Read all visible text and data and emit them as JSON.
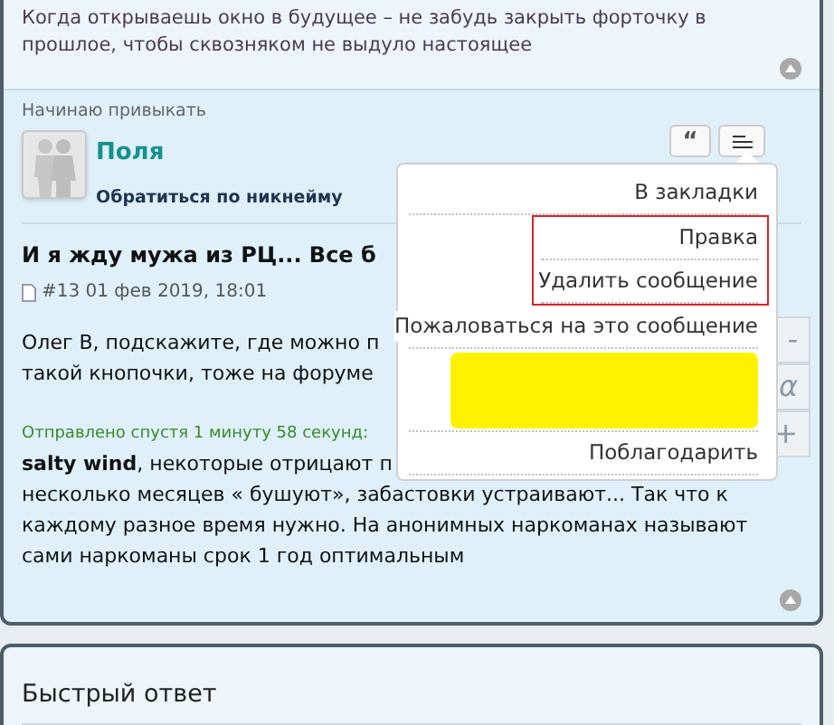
{
  "signature": {
    "text": "Когда открываешь окно в будущее – не забудь закрыть форточку в прошлое, чтобы сквозняком не выдуло настоящее"
  },
  "post": {
    "user_title": "Начинаю привыкать",
    "username": "Поля",
    "mention_link": "Обратиться по никнейму",
    "thread_title": "И я жду мужа из РЦ... Все б",
    "meta": "#13 01 фев 2019, 18:01",
    "body_lines": [
      "Олег В, подскажите, где можно п",
      "такой кнопочки, тоже на форуме"
    ],
    "merged_note": "Отправлено спустя 1 минуту 58 секунд:",
    "reply_lines": [
      "**salty wind**, некоторые отрицают п",
      "несколько месяцев « бушуют», забастовки устраивают... Так что к",
      "каждому разное время нужно. На анонимных наркоманах называют",
      "сами наркоманы срок 1 год оптимальным"
    ],
    "quote_button": "“",
    "editor_buttons": [
      "-",
      "α",
      "+"
    ]
  },
  "menu": {
    "items": [
      {
        "label": "В закладки",
        "kind": "item",
        "highlighted": false
      },
      {
        "label": "Правка",
        "kind": "item",
        "highlighted": true
      },
      {
        "label": "Удалить сообщение",
        "kind": "item",
        "highlighted": true
      },
      {
        "label": "Пожаловаться на это сообщение",
        "kind": "item",
        "highlighted": false
      },
      {
        "kind": "redacted",
        "highlighted": false
      },
      {
        "label": "Поблагодарить",
        "kind": "item",
        "highlighted": false
      }
    ]
  },
  "quick_reply": {
    "title": "Быстрый ответ"
  }
}
